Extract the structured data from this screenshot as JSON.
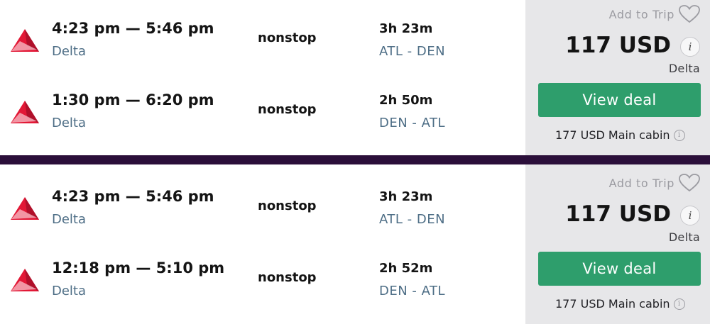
{
  "results": [
    {
      "legs": [
        {
          "times": "4:23 pm — 5:46 pm",
          "airline": "Delta",
          "stops": "nonstop",
          "duration": "3h 23m",
          "route": "ATL - DEN"
        },
        {
          "times": "1:30 pm — 6:20 pm",
          "airline": "Delta",
          "stops": "nonstop",
          "duration": "2h 50m",
          "route": "DEN - ATL"
        }
      ],
      "add_to_trip": "Add to Trip",
      "price": "117 USD",
      "info_glyph": "i",
      "price_airline": "Delta",
      "view_deal": "View deal",
      "main_cabin": "177 USD Main cabin",
      "small_info_glyph": "i"
    },
    {
      "legs": [
        {
          "times": "4:23 pm — 5:46 pm",
          "airline": "Delta",
          "stops": "nonstop",
          "duration": "3h 23m",
          "route": "ATL - DEN"
        },
        {
          "times": "12:18 pm — 5:10 pm",
          "airline": "Delta",
          "stops": "nonstop",
          "duration": "2h 52m",
          "route": "DEN - ATL"
        }
      ],
      "add_to_trip": "Add to Trip",
      "price": "117 USD",
      "info_glyph": "i",
      "price_airline": "Delta",
      "view_deal": "View deal",
      "main_cabin": "177 USD Main cabin",
      "small_info_glyph": "i"
    }
  ],
  "icons": {
    "airline_logo": "delta-logo-icon",
    "heart": "heart-icon",
    "info": "info-icon"
  },
  "colors": {
    "button": "#2e9e6c",
    "divider": "#2b0f3a",
    "secondary_text": "#4e6e86",
    "panel": "#e7e7e9",
    "delta_red": "#e21836"
  }
}
